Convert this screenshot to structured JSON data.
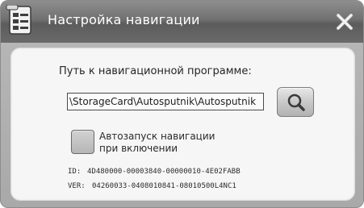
{
  "window": {
    "title": "Настройка навигации",
    "icons": {
      "app": "settings-list-icon",
      "close": "close-icon"
    }
  },
  "path_setting": {
    "label": "Путь к навигационной программе:",
    "value": "\\StorageCard\\Autosputnik\\Autosputnik",
    "browse_icon": "search-icon"
  },
  "autostart": {
    "line1": "Автозапуск навигации",
    "line2": "при включении",
    "checked": false
  },
  "info": {
    "id_label": "ID:",
    "id_value": "4D480000-00003840-00000010-4E02FABB",
    "ver_label": "VER:",
    "ver_value": "04260033-0408010841-08010500L4NC1"
  },
  "colors": {
    "titlebar": "#6a6a6a",
    "window_frame": "#b0b0b0",
    "panel": "#f6f6f6",
    "text": "#262626"
  }
}
